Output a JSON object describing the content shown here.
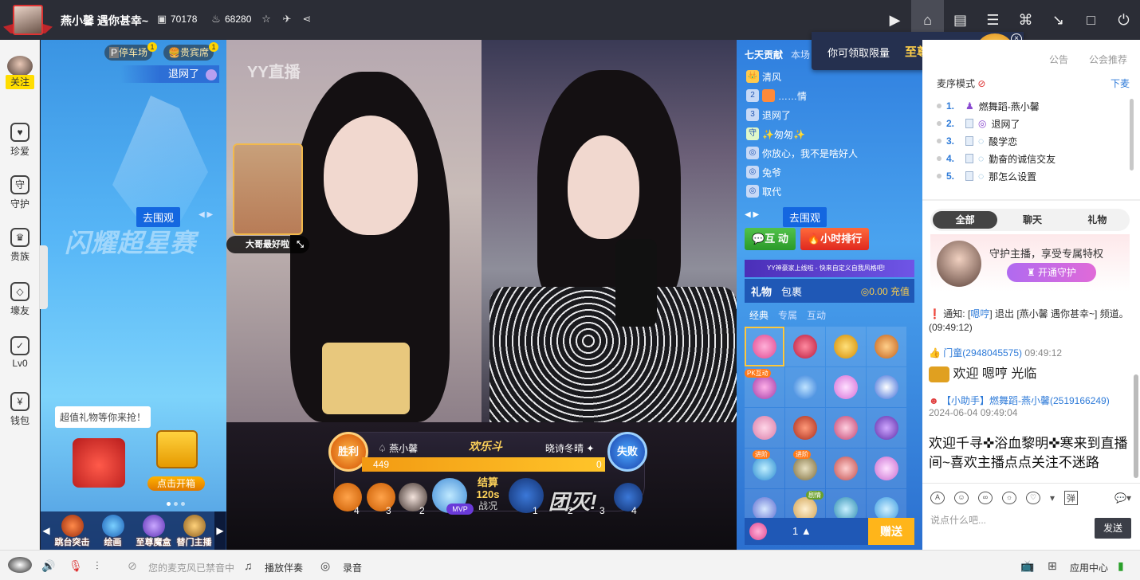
{
  "topbar": {
    "title": "燕小馨 遇你甚幸~",
    "room_id": "70178",
    "heat": "68280",
    "icons": [
      "star-icon",
      "plane-icon",
      "share-icon",
      "video-icon",
      "home-icon",
      "badge-icon",
      "panel-icon",
      "gamepad-icon",
      "shrink-icon",
      "maximize-icon",
      "power-icon"
    ]
  },
  "leftnav": {
    "follow": "关注",
    "items": [
      {
        "label": "珍爱",
        "icon": "heart-icon"
      },
      {
        "label": "守护",
        "icon": "shield-icon"
      },
      {
        "label": "贵族",
        "icon": "crown-icon"
      },
      {
        "label": "壕友",
        "icon": "diamond-icon"
      },
      {
        "label": "Lv0",
        "icon": "level-icon"
      },
      {
        "label": "钱包",
        "icon": "wallet-icon"
      }
    ]
  },
  "leftpanel": {
    "parking": "停车场",
    "parking_count": "1",
    "vip_seat": "贵宾席",
    "vip_count": "1",
    "user": "退网了",
    "event_title": "闪耀超星赛",
    "go_watch": "去围观",
    "bubble": "超值礼物等你来抢！",
    "open_chest": "点击开箱",
    "bottom_tiles": [
      "跳台突击",
      "绘画",
      "至尊魔盒",
      "替门主播"
    ]
  },
  "video": {
    "watermark": "YY直播",
    "sticker_label": "大哥最好啦"
  },
  "pk": {
    "win_label": "胜利",
    "lose_label": "失败",
    "left_name": "燕小馨",
    "right_name": "晓诗冬晴",
    "title": "欢乐斗",
    "left_score": "449",
    "right_score": "0",
    "left_score_value": 449,
    "right_score_value": 0,
    "left_avatar_nums": [
      "4",
      "3",
      "2"
    ],
    "mvp": "MVP",
    "settle": "结算",
    "timer": "120s",
    "battle": "战况",
    "right_avatar_nums": [
      "1",
      "2",
      "3",
      "4"
    ],
    "wipe": "团灭!"
  },
  "centerpanel": {
    "tab_active": "七天贡献",
    "tab_other": "本场",
    "vip_promo_text": "你可领取限量",
    "vip_promo_highlight": "至尊VIP",
    "rank": [
      {
        "badge": "👑",
        "name": "清风"
      },
      {
        "badge": "2",
        "name": "……情"
      },
      {
        "badge": "3",
        "name": "退网了"
      },
      {
        "badge": "守",
        "name": "✨匆匆✨"
      },
      {
        "badge": "◎",
        "name": "你放心，我不是啥好人"
      },
      {
        "badge": "◎",
        "name": "兔爷"
      },
      {
        "badge": "◎",
        "name": "取代"
      }
    ],
    "go_watch": "去围观",
    "interact": "互 动",
    "hour_rank": "小时排行",
    "ad": "YY神豪家上线啦 - 快来自定义自我风格吧!",
    "gift_tab": "礼物",
    "bag_tab": "包裹",
    "coin": "0.00",
    "recharge": "充值",
    "sub_tabs": [
      "经典",
      "专属",
      "互动"
    ],
    "gift_tags": [
      "PK互动",
      "进阶",
      "进阶",
      "剧情"
    ],
    "quantity": "1",
    "send": "赠送"
  },
  "rightpanel": {
    "tabs": [
      "公告",
      "公会推荐"
    ],
    "queue_mode": "麦序模式",
    "down_mic": "下麦",
    "queue": [
      {
        "n": "1.",
        "name": "燃舞蹈-燕小馨"
      },
      {
        "n": "2.",
        "name": "退网了"
      },
      {
        "n": "3.",
        "name": "酸学恋"
      },
      {
        "n": "4.",
        "name": "勤奋的诚信交友"
      },
      {
        "n": "5.",
        "name": "那怎么设置"
      }
    ],
    "segments": [
      "全部",
      "聊天",
      "礼物"
    ],
    "guard_text": "守护主播，享受专属特权",
    "guard_button": "开通守护",
    "notice_prefix": "通知: [",
    "notice_user": "嗯哼",
    "notice_rest": "] 退出 [燕小馨 遇你甚幸~] 频道。(09:49:12)",
    "msg1_name": "门童(2948045575)",
    "msg1_time": "09:49:12",
    "msg1_text": "欢迎 嗯哼 光临",
    "msg2_name": "【小助手】燃舞蹈-燕小馨(2519166249)",
    "msg2_time": "2024-06-04 09:49:04",
    "sys_text": "欢迎千寻✜浴血黎明✜寒来到直播间~喜欢主播点点关注不迷路",
    "tool_bomb": "弹",
    "input_placeholder": "说点什么吧...",
    "send": "发送"
  },
  "statusbar": {
    "mic_hint": "您的麦克风已禁音中",
    "accompany": "播放伴奏",
    "record": "录音",
    "app_center": "应用中心"
  },
  "colors": {
    "topbar": "#2b2d36",
    "accent_blue": "#1467e0",
    "gift_send": "#ffb51a",
    "pk_orange": "#f29a12",
    "vip_gold": "#ffd04a"
  }
}
